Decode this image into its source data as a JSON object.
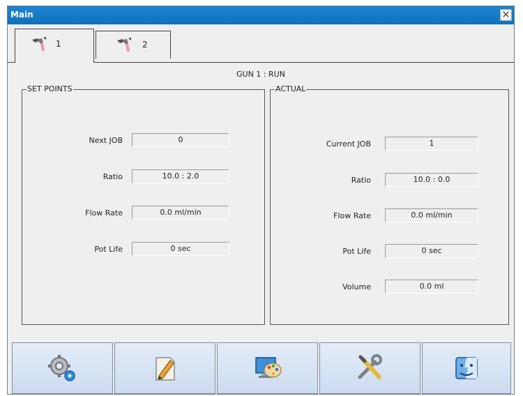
{
  "window": {
    "title": "Main",
    "close_glyph": "×"
  },
  "tabs": [
    {
      "label": "1",
      "icon": "spray-gun-icon",
      "active": true
    },
    {
      "label": "2",
      "icon": "spray-gun-icon",
      "active": false
    }
  ],
  "status": "GUN 1 : RUN",
  "set_points": {
    "title": "SET POINTS",
    "rows": [
      {
        "label": "Next JOB",
        "value": "0"
      },
      {
        "label": "Ratio",
        "value": "10.0 : 2.0"
      },
      {
        "label": "Flow Rate",
        "value": "0.0 ml/min"
      },
      {
        "label": "Pot Life",
        "value": "0 sec"
      }
    ]
  },
  "actual": {
    "title": "ACTUAL",
    "rows": [
      {
        "label": "Current JOB",
        "value": "1"
      },
      {
        "label": "Ratio",
        "value": "10.0 : 0.0"
      },
      {
        "label": "Flow Rate",
        "value": "0.0 ml/min"
      },
      {
        "label": "Pot Life",
        "value": "0 sec"
      },
      {
        "label": "Volume",
        "value": "0.0 ml"
      }
    ]
  },
  "toolbar": [
    {
      "icon": "gears-settings-icon"
    },
    {
      "icon": "edit-document-icon"
    },
    {
      "icon": "paint-palette-icon"
    },
    {
      "icon": "tools-icon"
    },
    {
      "icon": "finder-face-icon"
    }
  ],
  "colors": {
    "titlebar": "#1170bb",
    "window_bg": "#efefef",
    "button_bg": "#d6e3f4"
  }
}
